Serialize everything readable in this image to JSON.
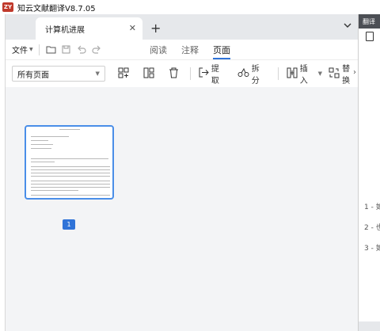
{
  "app": {
    "logo": "ZY",
    "title": "知云文献翻译V8.7.05"
  },
  "tabs": [
    {
      "label": "计算机进展",
      "close": "✕"
    }
  ],
  "new_tab": "+",
  "menu": {
    "file": "文件"
  },
  "modes": [
    {
      "label": "阅读"
    },
    {
      "label": "注释"
    },
    {
      "label": "页面",
      "active": true
    }
  ],
  "toolbar": {
    "page_select": "所有页面",
    "extract": "提取",
    "split": "拆分",
    "insert": "插入",
    "replace": "替换"
  },
  "page": {
    "number": "1"
  },
  "right_panel": {
    "header": "翻译",
    "items": [
      "1 - 如",
      "2 - 也",
      "3 - 如"
    ]
  },
  "colors": {
    "accent": "#2f73d8",
    "header": "#4c4f55",
    "logo": "#c0392b"
  }
}
